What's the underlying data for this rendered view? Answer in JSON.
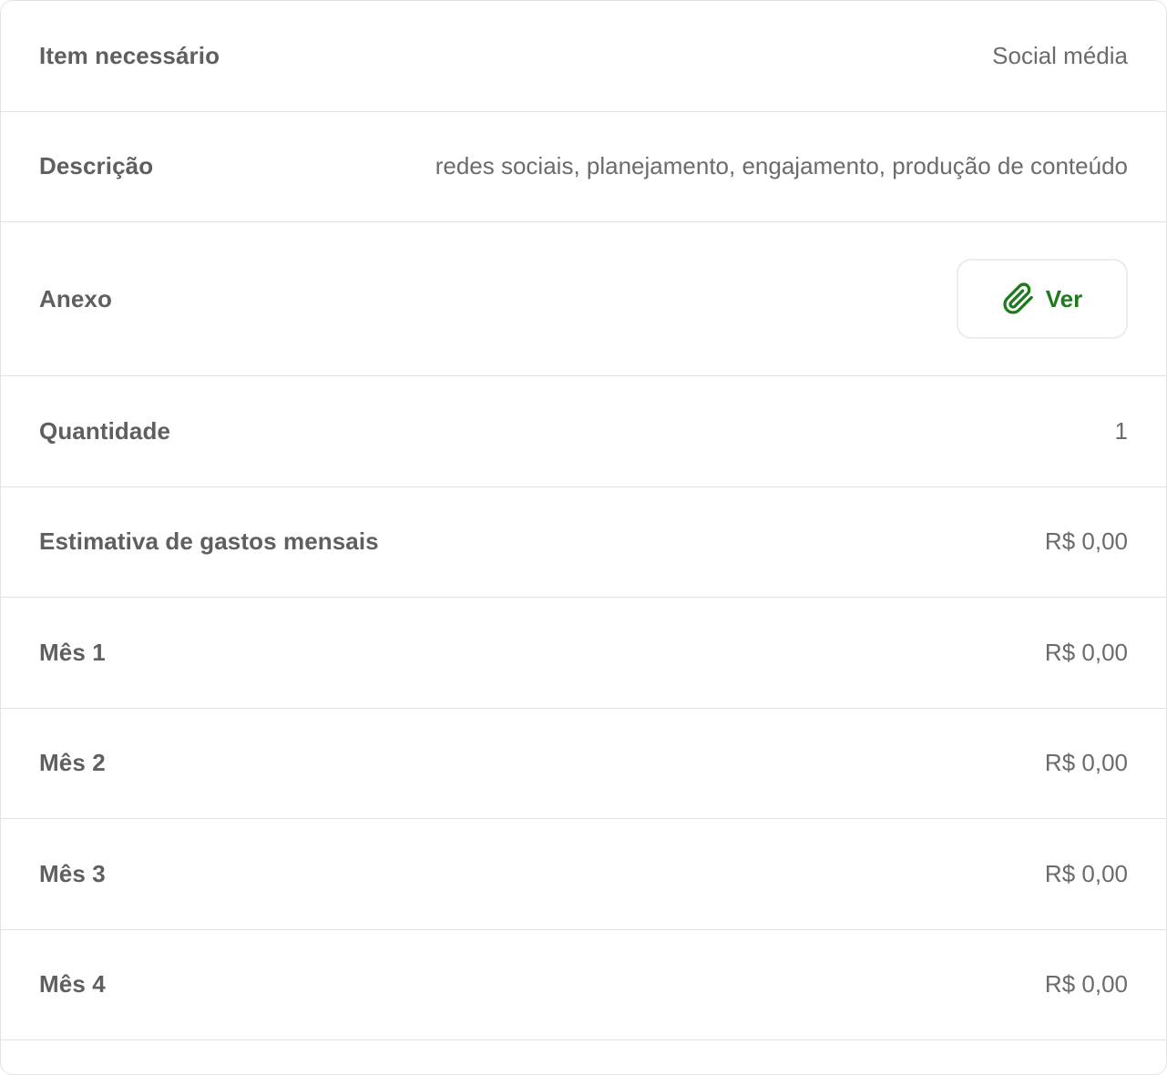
{
  "details": {
    "rows": [
      {
        "label": "Item necessário",
        "value": "Social média"
      },
      {
        "label": "Descrição",
        "value": "redes sociais, planejamento, engajamento, produção de conteúdo"
      },
      {
        "label": "Anexo",
        "button_label": "Ver",
        "icon": "paperclip-icon"
      },
      {
        "label": "Quantidade",
        "value": "1"
      },
      {
        "label": "Estimativa de gastos mensais",
        "value": "R$ 0,00"
      },
      {
        "label": "Mês 1",
        "value": "R$ 0,00"
      },
      {
        "label": "Mês 2",
        "value": "R$ 0,00"
      },
      {
        "label": "Mês 3",
        "value": "R$ 0,00"
      },
      {
        "label": "Mês 4",
        "value": "R$ 0,00"
      }
    ]
  },
  "colors": {
    "accent_green": "#1f7a1f",
    "label_text": "#5f5f5f",
    "value_text": "#6b6b6b",
    "divider": "#e3e3e3"
  }
}
